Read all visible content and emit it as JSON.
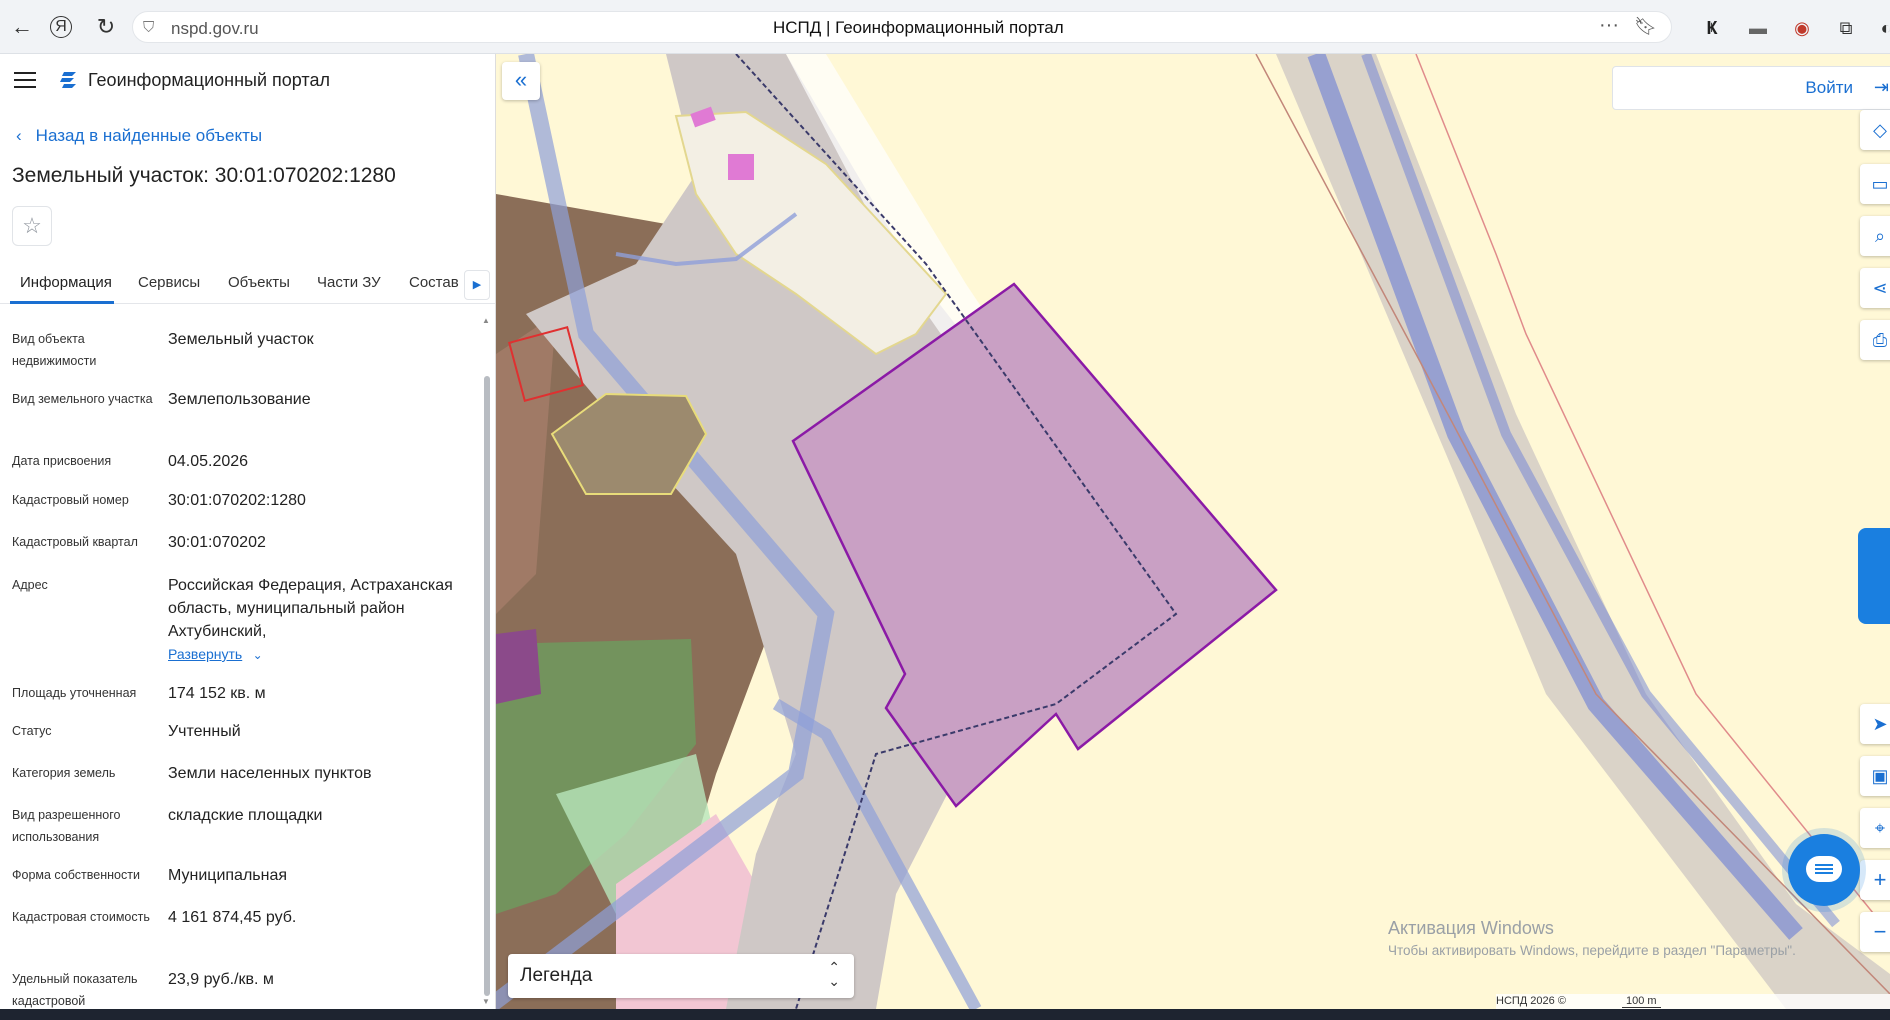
{
  "browser": {
    "url": "nspd.gov.ru",
    "tab_title": "НСПД | Геоинформационный портал",
    "back_icon": "←",
    "yandex_icon": "Я",
    "reload_icon": "↻",
    "more_icon": "···"
  },
  "sidebar": {
    "portal_name": "Геоинформационный портал",
    "back_link": "Назад в найденные объекты",
    "object_title": "Земельный участок: 30:01:070202:1280",
    "tabs": [
      "Информация",
      "Сервисы",
      "Объекты",
      "Части ЗУ",
      "Состав"
    ],
    "properties": [
      {
        "label": "Вид объекта недвижимости",
        "value": "Земельный участок"
      },
      {
        "label": "Вид земельного участка",
        "value": "Землепользование"
      },
      {
        "label": "Дата присвоения",
        "value": "04.05.2026"
      },
      {
        "label": "Кадастровый номер",
        "value": "30:01:070202:1280"
      },
      {
        "label": "Кадастровый квартал",
        "value": "30:01:070202"
      },
      {
        "label": "Адрес",
        "value": "Российская Федерация, Астраханская область, муниципальный район Ахтубинский,"
      },
      {
        "label": "Площадь уточненная",
        "value": "174 152 кв. м"
      },
      {
        "label": "Статус",
        "value": "Учтенный"
      },
      {
        "label": "Категория земель",
        "value": "Земли населенных пунктов"
      },
      {
        "label": "Вид разрешенного использования",
        "value": "складские площадки"
      },
      {
        "label": "Форма собственности",
        "value": "Муниципальная"
      },
      {
        "label": "Кадастровая стоимость",
        "value": "4 161 874,45 руб."
      },
      {
        "label": "Удельный показатель кадастровой",
        "value": "23,9 руб./кв. м"
      }
    ],
    "expand_link": "Развернуть"
  },
  "map": {
    "login_label": "Войти",
    "legend_label": "Легенда",
    "watermark_title": "Активация Windows",
    "watermark_text": "Чтобы активировать Windows, перейдите в раздел \"Параметры\".",
    "copyright": "НСПД 2026 ©",
    "scale": "100 m",
    "colors": {
      "accent": "#1a6fd1",
      "parcel_fill": "#c9a0c4",
      "parcel_stroke": "#8b1aa6",
      "zone_yellow": "#fff8d6",
      "road_blue": "#8f9fd9"
    }
  }
}
